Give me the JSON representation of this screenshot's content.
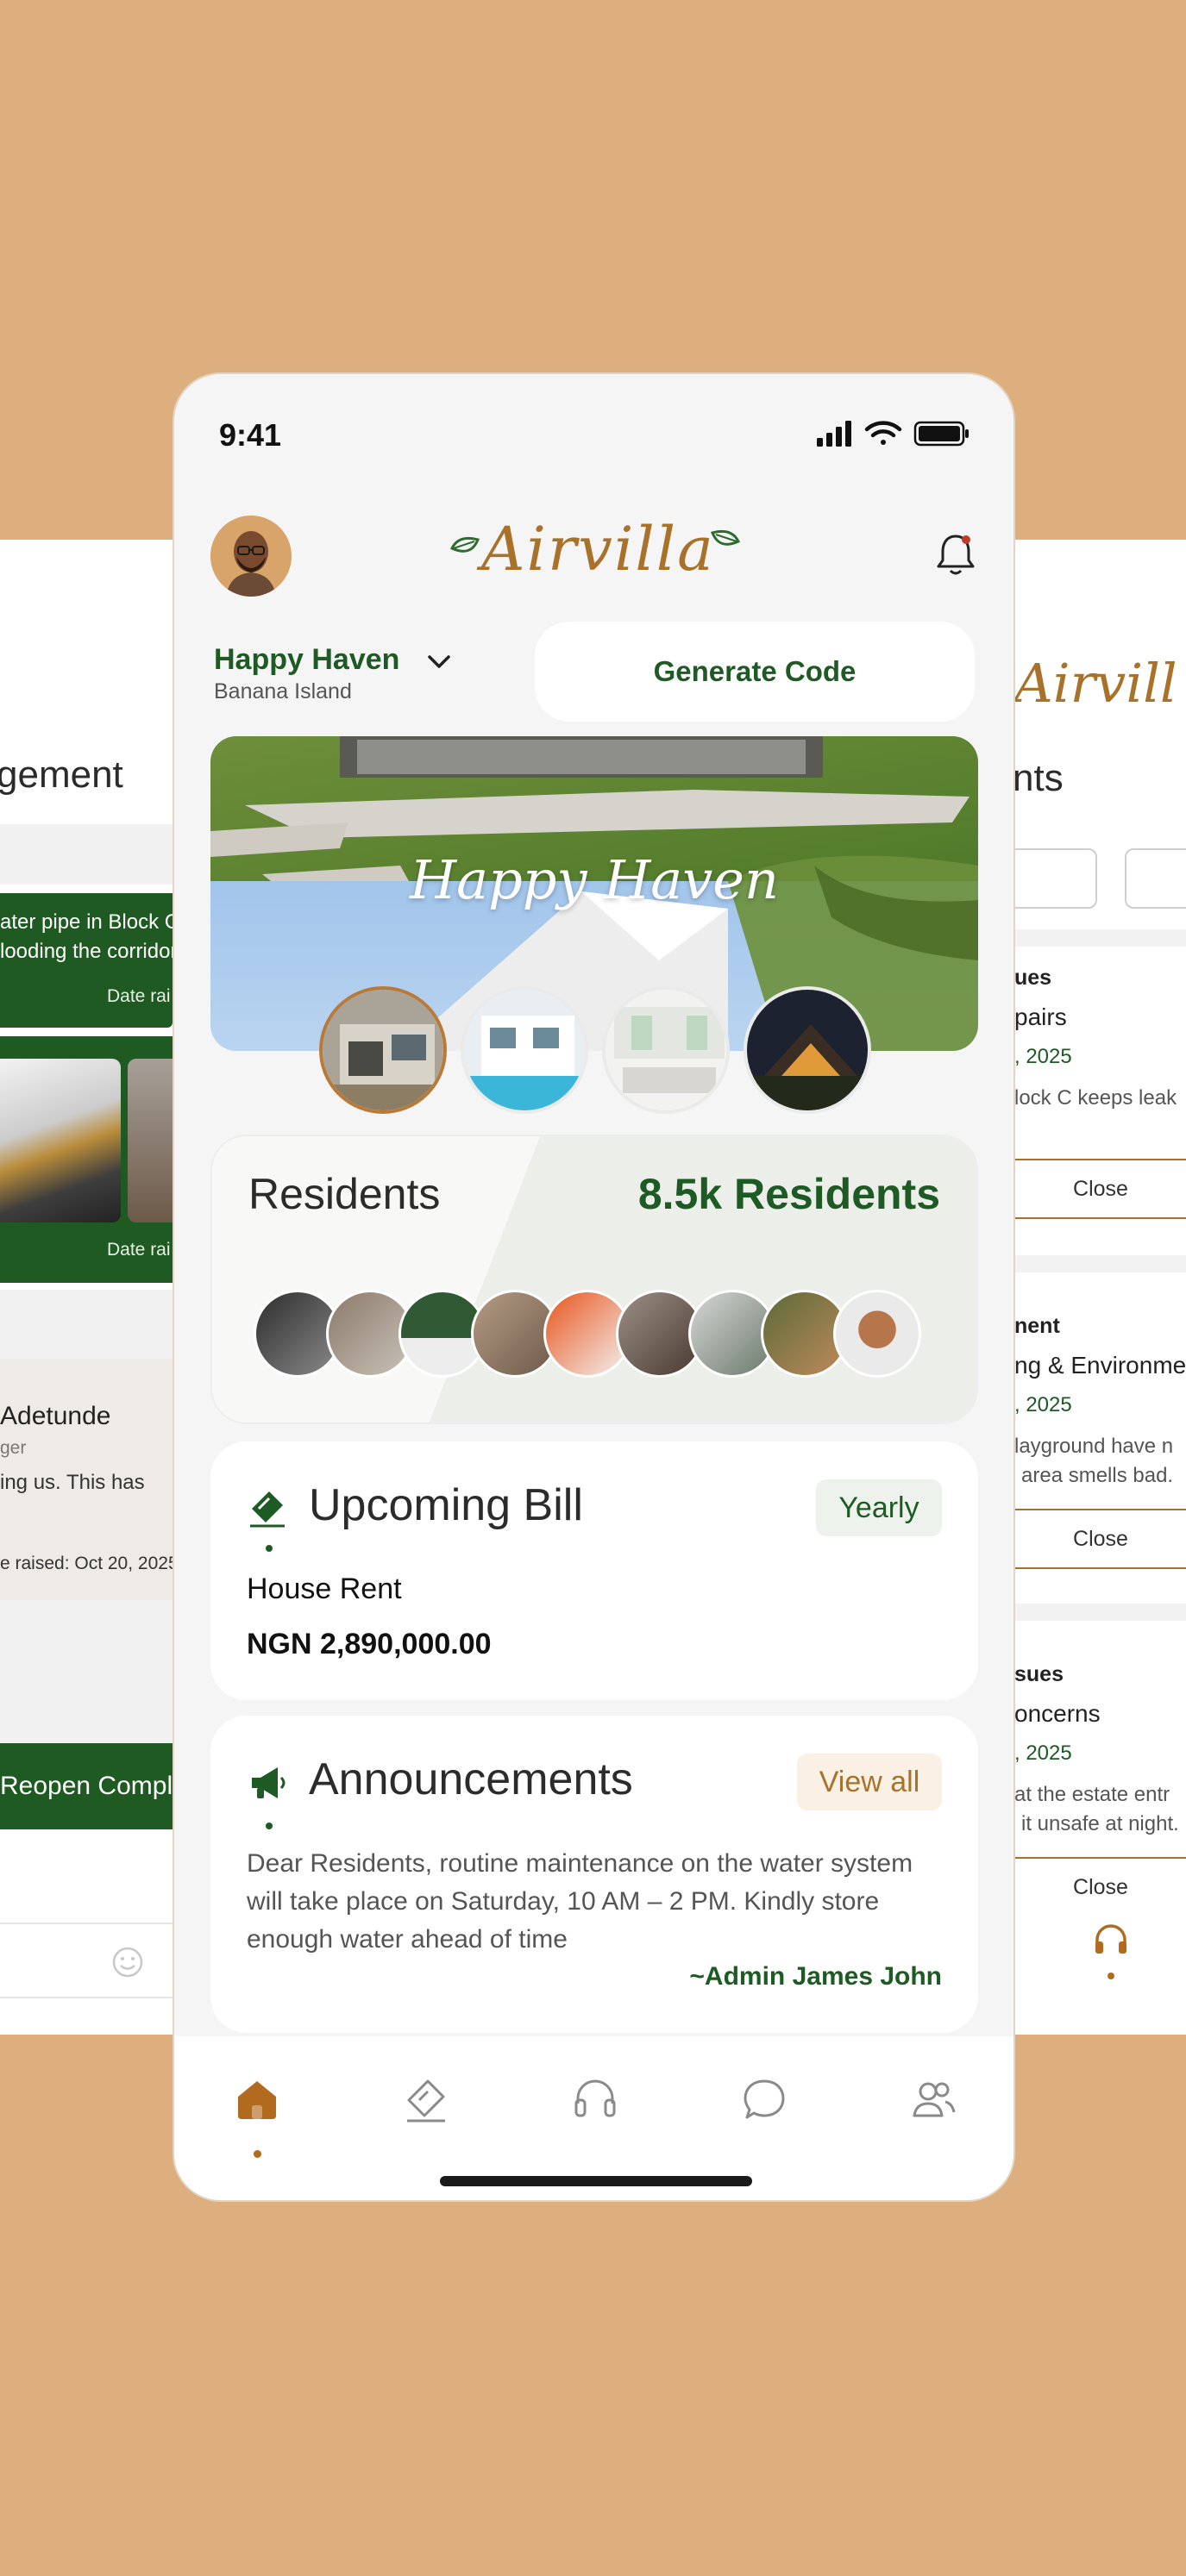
{
  "status": {
    "time": "9:41"
  },
  "header": {
    "logo_text": "Airvilla"
  },
  "estate": {
    "name": "Happy Haven",
    "location": "Banana Island",
    "generate_label": "Generate Code"
  },
  "hero": {
    "title": "Happy Haven"
  },
  "residents": {
    "title": "Residents",
    "count": "8.5k Residents"
  },
  "bill": {
    "title": "Upcoming Bill",
    "period": "Yearly",
    "item": "House Rent",
    "amount": "NGN 2,890,000.00"
  },
  "announcements": {
    "title": "Announcements",
    "view_all": "View all",
    "body": "Dear Residents, routine maintenance on the water system will take place on Saturday, 10 AM – 2 PM. Kindly store enough water ahead of time",
    "signature": "~Admin James John"
  },
  "nav": {
    "items": [
      "home-icon",
      "ticket-icon",
      "headset-icon",
      "chat-icon",
      "users-icon"
    ],
    "active": 0
  },
  "left_screen": {
    "title": "gement",
    "complaint1_line1": "ater pipe in Block C",
    "complaint1_line2": "looding the corridor",
    "date_raised_label": "Date rai",
    "complaint2_date": "Date rai",
    "person_name": "Adetunde",
    "person_role": "ger",
    "message": "ing us. This has",
    "raised_date": "e raised: Oct 20, 2025",
    "reopen_label": "Reopen Compla"
  },
  "right_screen": {
    "logo_text": "Airvill",
    "title": "nts",
    "issues": [
      {
        "category": "ues",
        "title": "pairs",
        "date": ", 2025",
        "desc1": "lock C keeps leak",
        "desc2": "",
        "close": "Close"
      },
      {
        "category": "nent",
        "title": "ng & Environme",
        "date": ", 2025",
        "desc1": "layground have n",
        "desc2": "area smells bad.",
        "close": "Close"
      },
      {
        "category": "sues",
        "title": "oncerns",
        "date": ", 2025",
        "desc1": "at the estate entr",
        "desc2": "it unsafe at night.",
        "close": "Close"
      }
    ]
  },
  "colors": {
    "background": "#DEAF7E",
    "brand_green": "#1E5A23",
    "brand_gold": "#A9722B"
  }
}
